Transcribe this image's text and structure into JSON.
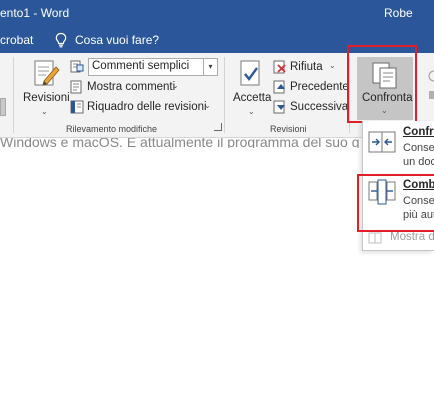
{
  "titlebar": {
    "doc_title": "ento1  -  Word",
    "user_name": "Robe"
  },
  "tabs": {
    "acrobat": "crobat",
    "tell_me": "Cosa vuoi fare?"
  },
  "ribbon": {
    "revisioni_button": "Revisioni",
    "markup_combo_value": "Commenti semplici",
    "show_comments": "Mostra commenti",
    "revision_pane": "Riquadro delle revisioni",
    "group_tracking_label": "Rilevamento modifiche",
    "accept_button": "Accetta",
    "reject": "Rifiuta",
    "previous": "Precedente",
    "next": "Successiva",
    "group_revisions_label": "Revisioni",
    "compare_button": "Confronta"
  },
  "document": {
    "visible_text": "Windows e macOS. È attualmente il programma del suo genere più"
  },
  "compare_menu": {
    "compare_title": "Confro",
    "compare_desc_1": "Conser",
    "compare_desc_2": "un doc",
    "combine_title": "Combi",
    "combine_desc_1": "Conser",
    "combine_desc_2": "più aut",
    "show_source": "Mostra do"
  },
  "colors": {
    "title_bar": "#2b579a",
    "ribbon_bg": "#f3f3f3",
    "highlight_red": "#e41e26",
    "pressed_button": "#c5c5c5"
  }
}
